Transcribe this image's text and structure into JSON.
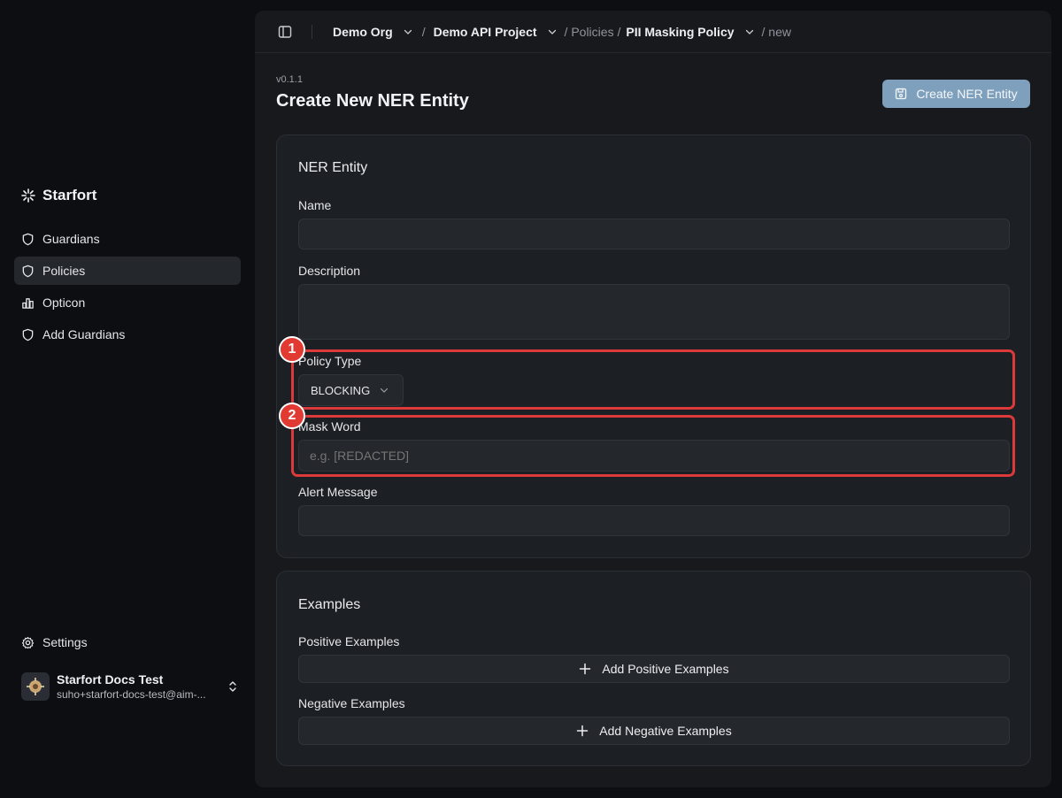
{
  "sidebar": {
    "brand": "Starfort",
    "items": [
      {
        "label": "Guardians",
        "icon": "shield-icon"
      },
      {
        "label": "Policies",
        "icon": "shield-icon",
        "active": true
      },
      {
        "label": "Opticon",
        "icon": "bar-chart-icon"
      },
      {
        "label": "Add Guardians",
        "icon": "shield-icon"
      }
    ],
    "settings_label": "Settings",
    "user": {
      "name": "Starfort Docs Test",
      "email": "suho+starfort-docs-test@aim-..."
    }
  },
  "breadcrumb": {
    "org": "Demo Org",
    "project": "Demo API Project",
    "policies": "/ Policies /",
    "policy": "PII Masking Policy",
    "current": "/ new",
    "sep": "/"
  },
  "header": {
    "version": "v0.1.1",
    "title": "Create New NER Entity",
    "create_button": "Create NER Entity"
  },
  "entity_card": {
    "title": "NER Entity",
    "name_label": "Name",
    "name_value": "",
    "description_label": "Description",
    "description_value": "",
    "policy_type_label": "Policy Type",
    "policy_type_value": "BLOCKING",
    "mask_word_label": "Mask Word",
    "mask_word_placeholder": "e.g. [REDACTED]",
    "alert_label": "Alert Message",
    "alert_value": ""
  },
  "examples_card": {
    "title": "Examples",
    "positive_label": "Positive Examples",
    "positive_button": "Add Positive Examples",
    "negative_label": "Negative Examples",
    "negative_button": "Add Negative Examples"
  },
  "annotations": {
    "badge_1": "1",
    "badge_2": "2"
  },
  "colors": {
    "accent": "#7ea0bd",
    "highlight": "#dc3a3a",
    "background": "#0c0e11",
    "panel": "#17191d"
  }
}
